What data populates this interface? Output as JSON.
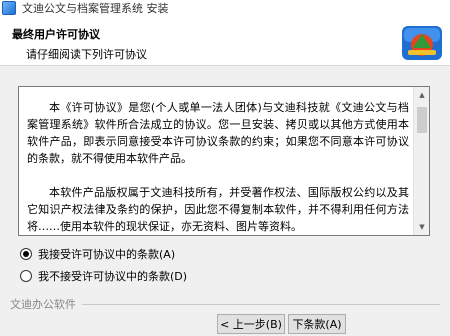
{
  "window": {
    "title": "文迪公文与档案管理系统 安装"
  },
  "header": {
    "title": "最终用户许可协议",
    "subtitle": "请仔细阅读下列许可协议"
  },
  "license": {
    "paragraphs": [
      "本《许可协议》是您(个人或单一法人团体)与文迪科技就《文迪公文与档案管理系统》软件所合法成立的协议。您一旦安装、拷贝或以其他方式使用本软件产品，即表示同意接受本许可协议条款的约束；如果您不同意本许可协议的条款，就不得使用本软件产品。",
      "本软件产品版权属于文迪科技所有，并受著作权法、国际版权公约以及其它知识产权法律及条约的保护，因此您不得复制本软件，并不得利用任何方法将……使用本软件的现状保证，亦无资料、图片等资料。"
    ]
  },
  "options": {
    "accept_label": "我接受许可协议中的条款(A)",
    "decline_label": "我不接受许可协议中的条款(D)",
    "selected": "accept"
  },
  "footer": {
    "brand": "文迪办公软件",
    "back_label": "< 上一步(B)",
    "next_label": "下条款(A)"
  },
  "icons": {
    "app": "installer-app-icon",
    "logo": "installer-logo-icon",
    "scroll_up": "scroll-up-arrow-icon",
    "scroll_down": "scroll-down-arrow-icon"
  },
  "colors": {
    "header_bg": "#ffffff",
    "body_bg": "#f0f0f0",
    "button_bg": "#e1e1e1",
    "logo_primary": "#1e6fd1",
    "logo_accent": "#e5461b"
  }
}
